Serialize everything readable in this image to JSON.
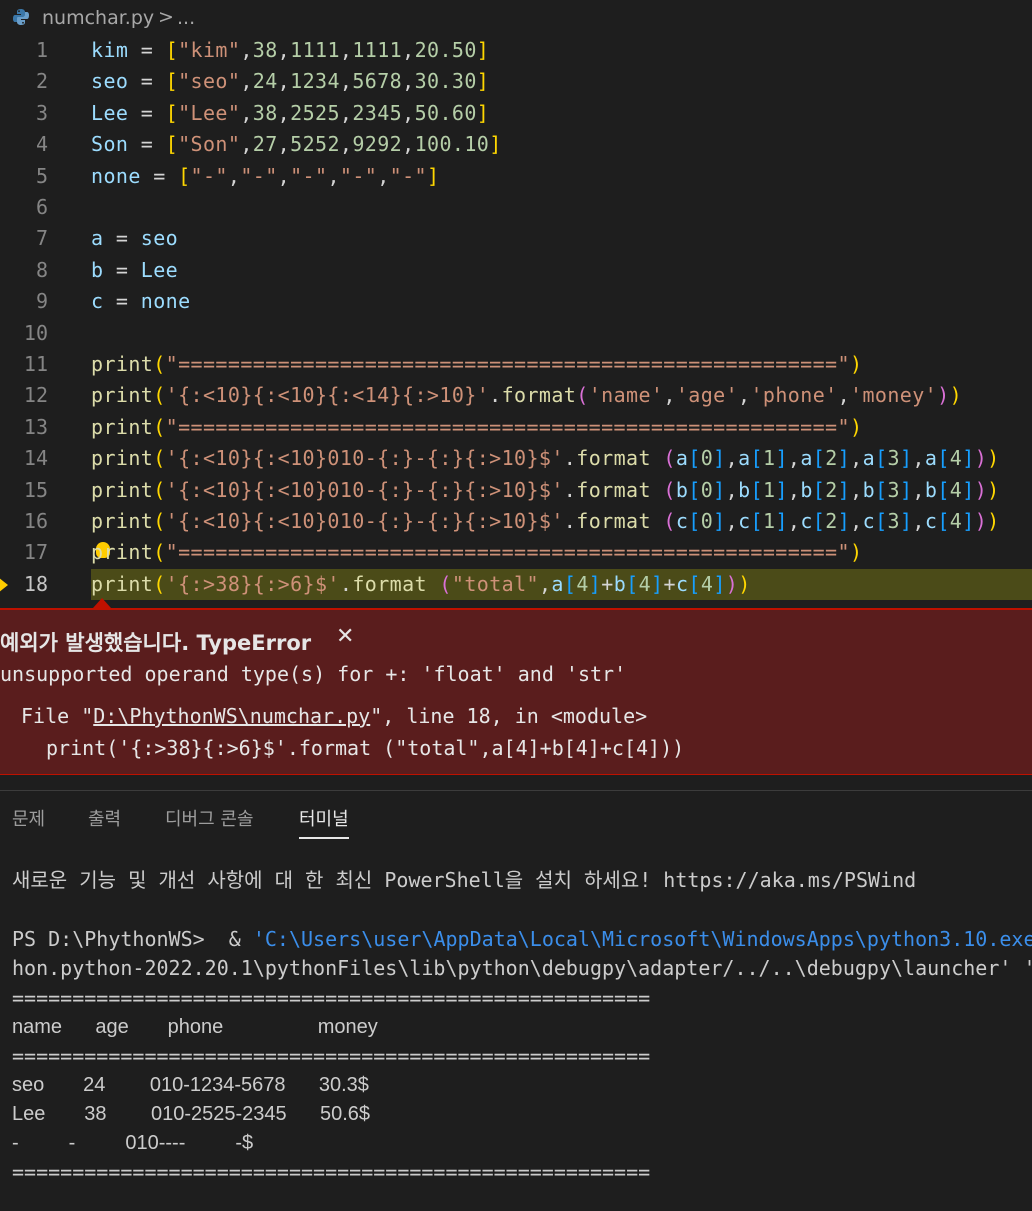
{
  "breadcrumb": {
    "file": "numchar.py",
    "separator": ">",
    "more": "..."
  },
  "editor": {
    "active_line": 18,
    "lines": [
      {
        "no": "1",
        "tokens": [
          [
            "v",
            "kim"
          ],
          [
            "",
            "="
          ],
          [
            "b1",
            "["
          ],
          [
            "s",
            "\"kim\""
          ],
          [
            "",
            ","
          ],
          [
            "n",
            "38"
          ],
          [
            "",
            ","
          ],
          [
            "n",
            "1111"
          ],
          [
            "",
            ","
          ],
          [
            "n",
            "1111"
          ],
          [
            "",
            ","
          ],
          [
            "n",
            "20.50"
          ],
          [
            "b1",
            "]"
          ]
        ]
      },
      {
        "no": "2",
        "tokens": [
          [
            "v",
            "seo"
          ],
          [
            "",
            "="
          ],
          [
            "b1",
            "["
          ],
          [
            "s",
            "\"seo\""
          ],
          [
            "",
            ","
          ],
          [
            "n",
            "24"
          ],
          [
            "",
            ","
          ],
          [
            "n",
            "1234"
          ],
          [
            "",
            ","
          ],
          [
            "n",
            "5678"
          ],
          [
            "",
            ","
          ],
          [
            "n",
            "30.30"
          ],
          [
            "b1",
            "]"
          ]
        ]
      },
      {
        "no": "3",
        "tokens": [
          [
            "v",
            "Lee"
          ],
          [
            "",
            "="
          ],
          [
            "b1",
            "["
          ],
          [
            "s",
            "\"Lee\""
          ],
          [
            "",
            ","
          ],
          [
            "n",
            "38"
          ],
          [
            "",
            ","
          ],
          [
            "n",
            "2525"
          ],
          [
            "",
            ","
          ],
          [
            "n",
            "2345"
          ],
          [
            "",
            ","
          ],
          [
            "n",
            "50.60"
          ],
          [
            "b1",
            "]"
          ]
        ]
      },
      {
        "no": "4",
        "tokens": [
          [
            "v",
            "Son"
          ],
          [
            "",
            "="
          ],
          [
            "b1",
            "["
          ],
          [
            "s",
            "\"Son\""
          ],
          [
            "",
            ","
          ],
          [
            "n",
            "27"
          ],
          [
            "",
            ","
          ],
          [
            "n",
            "5252"
          ],
          [
            "",
            ","
          ],
          [
            "n",
            "9292"
          ],
          [
            "",
            ","
          ],
          [
            "n",
            "100.10"
          ],
          [
            "b1",
            "]"
          ]
        ]
      },
      {
        "no": "5",
        "tokens": [
          [
            "v",
            "none"
          ],
          [
            "",
            "="
          ],
          [
            "b1",
            "["
          ],
          [
            "s",
            "\"-\""
          ],
          [
            "",
            ","
          ],
          [
            "s",
            "\"-\""
          ],
          [
            "",
            ","
          ],
          [
            "s",
            "\"-\""
          ],
          [
            "",
            ","
          ],
          [
            "s",
            "\"-\""
          ],
          [
            "",
            ","
          ],
          [
            "s",
            "\"-\""
          ],
          [
            "b1",
            "]"
          ]
        ]
      },
      {
        "no": "6",
        "tokens": []
      },
      {
        "no": "7",
        "tokens": [
          [
            "v",
            "a"
          ],
          [
            "",
            "="
          ],
          [
            "v",
            "seo"
          ]
        ]
      },
      {
        "no": "8",
        "tokens": [
          [
            "v",
            "b"
          ],
          [
            "",
            "="
          ],
          [
            "v",
            "Lee"
          ]
        ]
      },
      {
        "no": "9",
        "tokens": [
          [
            "v",
            "c"
          ],
          [
            "",
            "="
          ],
          [
            "v",
            "none"
          ]
        ]
      },
      {
        "no": "10",
        "tokens": []
      },
      {
        "no": "11",
        "tokens": [
          [
            "f",
            "print"
          ],
          [
            "b1",
            "("
          ],
          [
            "s",
            "\"=====================================================\""
          ],
          [
            "b1",
            ")"
          ]
        ]
      },
      {
        "no": "12",
        "tokens": [
          [
            "f",
            "print"
          ],
          [
            "b1",
            "("
          ],
          [
            "s",
            "'{:<10}{:<10}{:<14}{:>10}'"
          ],
          [
            "",
            "."
          ],
          [
            "f",
            "format"
          ],
          [
            "b2",
            "("
          ],
          [
            "s",
            "'name'"
          ],
          [
            "",
            ","
          ],
          [
            "s",
            "'age'"
          ],
          [
            "",
            ","
          ],
          [
            "s",
            "'phone'"
          ],
          [
            "",
            ","
          ],
          [
            "s",
            "'money'"
          ],
          [
            "b2",
            ")"
          ],
          [
            "b1",
            ")"
          ]
        ]
      },
      {
        "no": "13",
        "tokens": [
          [
            "f",
            "print"
          ],
          [
            "b1",
            "("
          ],
          [
            "s",
            "\"=====================================================\""
          ],
          [
            "b1",
            ")"
          ]
        ]
      },
      {
        "no": "14",
        "tokens": [
          [
            "f",
            "print"
          ],
          [
            "b1",
            "("
          ],
          [
            "s",
            "'{:<10}{:<10}010-{:}-{:}{:>10}$'"
          ],
          [
            "",
            "."
          ],
          [
            "f",
            "format"
          ],
          [
            "",
            ""
          ],
          [
            "b2",
            "("
          ],
          [
            "v",
            "a"
          ],
          [
            "b3",
            "["
          ],
          [
            "n",
            "0"
          ],
          [
            "b3",
            "]"
          ],
          [
            "",
            ","
          ],
          [
            "v",
            "a"
          ],
          [
            "b3",
            "["
          ],
          [
            "n",
            "1"
          ],
          [
            "b3",
            "]"
          ],
          [
            "",
            ","
          ],
          [
            "v",
            "a"
          ],
          [
            "b3",
            "["
          ],
          [
            "n",
            "2"
          ],
          [
            "b3",
            "]"
          ],
          [
            "",
            ","
          ],
          [
            "v",
            "a"
          ],
          [
            "b3",
            "["
          ],
          [
            "n",
            "3"
          ],
          [
            "b3",
            "]"
          ],
          [
            "",
            ","
          ],
          [
            "v",
            "a"
          ],
          [
            "b3",
            "["
          ],
          [
            "n",
            "4"
          ],
          [
            "b3",
            "]"
          ],
          [
            "b2",
            ")"
          ],
          [
            "b1",
            ")"
          ]
        ]
      },
      {
        "no": "15",
        "tokens": [
          [
            "f",
            "print"
          ],
          [
            "b1",
            "("
          ],
          [
            "s",
            "'{:<10}{:<10}010-{:}-{:}{:>10}$'"
          ],
          [
            "",
            "."
          ],
          [
            "f",
            "format"
          ],
          [
            "",
            ""
          ],
          [
            "b2",
            "("
          ],
          [
            "v",
            "b"
          ],
          [
            "b3",
            "["
          ],
          [
            "n",
            "0"
          ],
          [
            "b3",
            "]"
          ],
          [
            "",
            ","
          ],
          [
            "v",
            "b"
          ],
          [
            "b3",
            "["
          ],
          [
            "n",
            "1"
          ],
          [
            "b3",
            "]"
          ],
          [
            "",
            ","
          ],
          [
            "v",
            "b"
          ],
          [
            "b3",
            "["
          ],
          [
            "n",
            "2"
          ],
          [
            "b3",
            "]"
          ],
          [
            "",
            ","
          ],
          [
            "v",
            "b"
          ],
          [
            "b3",
            "["
          ],
          [
            "n",
            "3"
          ],
          [
            "b3",
            "]"
          ],
          [
            "",
            ","
          ],
          [
            "v",
            "b"
          ],
          [
            "b3",
            "["
          ],
          [
            "n",
            "4"
          ],
          [
            "b3",
            "]"
          ],
          [
            "b2",
            ")"
          ],
          [
            "b1",
            ")"
          ]
        ]
      },
      {
        "no": "16",
        "tokens": [
          [
            "f",
            "print"
          ],
          [
            "b1",
            "("
          ],
          [
            "s",
            "'{:<10}{:<10}010-{:}-{:}{:>10}$'"
          ],
          [
            "",
            "."
          ],
          [
            "f",
            "format"
          ],
          [
            "",
            ""
          ],
          [
            "b2",
            "("
          ],
          [
            "v",
            "c"
          ],
          [
            "b3",
            "["
          ],
          [
            "n",
            "0"
          ],
          [
            "b3",
            "]"
          ],
          [
            "",
            ","
          ],
          [
            "v",
            "c"
          ],
          [
            "b3",
            "["
          ],
          [
            "n",
            "1"
          ],
          [
            "b3",
            "]"
          ],
          [
            "",
            ","
          ],
          [
            "v",
            "c"
          ],
          [
            "b3",
            "["
          ],
          [
            "n",
            "2"
          ],
          [
            "b3",
            "]"
          ],
          [
            "",
            ","
          ],
          [
            "v",
            "c"
          ],
          [
            "b3",
            "["
          ],
          [
            "n",
            "3"
          ],
          [
            "b3",
            "]"
          ],
          [
            "",
            ","
          ],
          [
            "v",
            "c"
          ],
          [
            "b3",
            "["
          ],
          [
            "n",
            "4"
          ],
          [
            "b3",
            "]"
          ],
          [
            "b2",
            ")"
          ],
          [
            "b1",
            ")"
          ]
        ]
      },
      {
        "no": "17",
        "tokens": [
          [
            "f",
            "print"
          ],
          [
            "b1",
            "("
          ],
          [
            "s",
            "\"=====================================================\""
          ],
          [
            "b1",
            ")"
          ]
        ]
      },
      {
        "no": "18",
        "tokens": [
          [
            "f",
            "print"
          ],
          [
            "b1",
            "("
          ],
          [
            "s",
            "'{:>38}{:>6}$'"
          ],
          [
            "",
            "."
          ],
          [
            "f",
            "format"
          ],
          [
            "",
            ""
          ],
          [
            "b2",
            "("
          ],
          [
            "s",
            "\"total\""
          ],
          [
            "",
            ","
          ],
          [
            "v",
            "a"
          ],
          [
            "b3",
            "["
          ],
          [
            "n",
            "4"
          ],
          [
            "b3",
            "]"
          ],
          [
            "",
            "+"
          ],
          [
            "v",
            "b"
          ],
          [
            "b3",
            "["
          ],
          [
            "n",
            "4"
          ],
          [
            "b3",
            "]"
          ],
          [
            "",
            "+"
          ],
          [
            "v",
            "c"
          ],
          [
            "b3",
            "["
          ],
          [
            "n",
            "4"
          ],
          [
            "b3",
            "]"
          ],
          [
            "b2",
            ")"
          ],
          [
            "b1",
            ")"
          ]
        ]
      }
    ]
  },
  "exception": {
    "title": "예외가 발생했습니다. TypeError",
    "close": "✕",
    "message": "unsupported operand type(s) for +: 'float' and 'str'",
    "trace_prefix": "File \"",
    "trace_file": "D:\\PhythonWS\\numchar.py",
    "trace_suffix": "\", line 18, in <module>",
    "trace_code": "print('{:>38}{:>6}$'.format (\"total\",a[4]+b[4]+c[4]))"
  },
  "panel": {
    "tabs": [
      {
        "label": "문제",
        "active": false
      },
      {
        "label": "출력",
        "active": false
      },
      {
        "label": "디버그 콘솔",
        "active": false
      },
      {
        "label": "터미널",
        "active": true
      }
    ],
    "terminal": {
      "notice": "새로운 기능 및 개선 사항에 대 한 최신 PowerShell을 설치 하세요! https://aka.ms/PSWind",
      "prompt": "PS D:\\PhythonWS>  & ",
      "cmd_path1": "'C:\\Users\\user\\AppData\\Local\\Microsoft\\WindowsApps\\python3.10.exe",
      "cmd_path2": "hon.python-2022.20.1\\pythonFiles\\lib\\python\\debugpy\\adapter/../..\\debugpy\\launcher' '",
      "output": [
        "=====================================================",
        "name      age       phone                 money",
        "=====================================================",
        "seo       24        010-1234-5678      30.3$",
        "Lee       38        010-2525-2345      50.6$",
        "-         -         010----         -$",
        "====================================================="
      ]
    }
  }
}
